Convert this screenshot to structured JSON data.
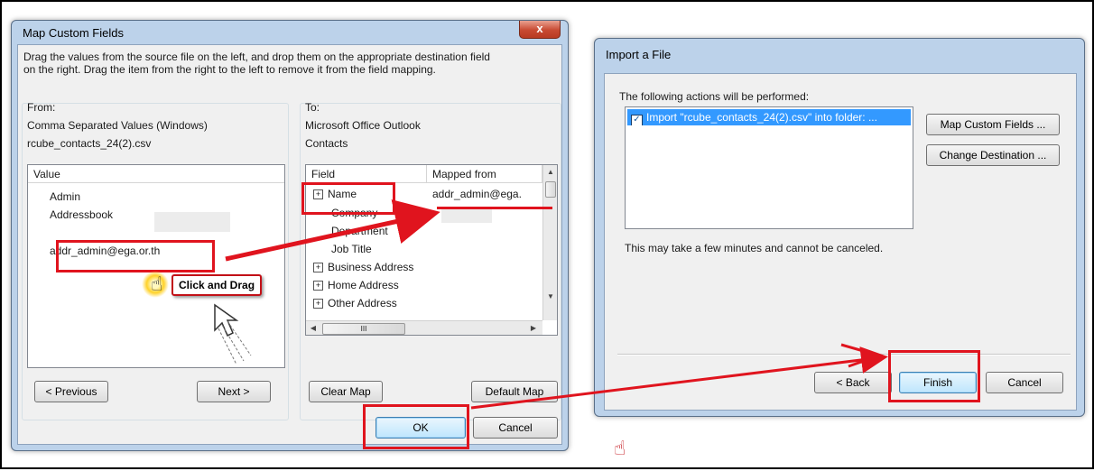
{
  "map_dialog": {
    "title": "Map Custom Fields",
    "close_label": "x",
    "instructions_line1": "Drag the values from the source file on the left, and drop them on the appropriate destination field",
    "instructions_line2": "on the right.  Drag the item from the right to the left to remove it from the field mapping.",
    "from": {
      "heading": "From:",
      "source_type": "Comma Separated Values (Windows)",
      "file_name": "rcube_contacts_24(2).csv",
      "column_header": "Value",
      "values": [
        "Admin",
        "Addressbook",
        "addr_admin@ega.or.th"
      ],
      "previous_label": "< Previous",
      "next_label": "Next >"
    },
    "to": {
      "heading": "To:",
      "app_name": "Microsoft Office Outlook",
      "folder": "Contacts",
      "col_field": "Field",
      "col_mapped": "Mapped from",
      "fields": [
        {
          "name": "Name",
          "expandable": true,
          "mapped": "addr_admin@ega."
        },
        {
          "name": "Company",
          "expandable": false,
          "mapped": ""
        },
        {
          "name": "Department",
          "expandable": false,
          "mapped": ""
        },
        {
          "name": "Job Title",
          "expandable": false,
          "mapped": ""
        },
        {
          "name": "Business Address",
          "expandable": true,
          "mapped": ""
        },
        {
          "name": "Home Address",
          "expandable": true,
          "mapped": ""
        },
        {
          "name": "Other Address",
          "expandable": true,
          "mapped": ""
        }
      ],
      "clear_map_label": "Clear Map",
      "default_map_label": "Default Map",
      "hscroll_grip": "III"
    },
    "ok_label": "OK",
    "cancel_label": "Cancel"
  },
  "import_dialog": {
    "title": "Import a File",
    "actions_label": "The following actions will be performed:",
    "action_item": "Import \"rcube_contacts_24(2).csv\" into folder: ...",
    "action_checked": true,
    "map_fields_label": "Map Custom Fields ...",
    "change_dest_label": "Change Destination ...",
    "note": "This may take a few minutes and cannot be canceled.",
    "back_label": "< Back",
    "finish_label": "Finish",
    "cancel_label": "Cancel"
  },
  "annotations": {
    "callout": "Click and Drag"
  },
  "colors": {
    "highlight": "#e0141e",
    "title_bar": "#bcd2ea",
    "dialog_bg": "#f0f0f0"
  }
}
